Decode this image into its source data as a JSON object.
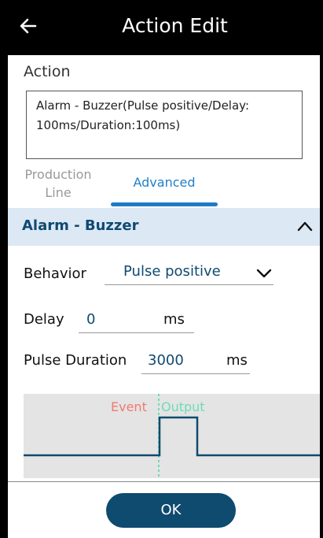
{
  "header": {
    "title": "Action Edit",
    "back_icon": "arrow-left-icon"
  },
  "action": {
    "label": "Action",
    "description": "Alarm - Buzzer(Pulse positive/Delay: 100ms/Duration:100ms)"
  },
  "tabs": [
    {
      "label": "Production\nLine",
      "selected": false
    },
    {
      "label": "Advanced",
      "selected": true
    }
  ],
  "panel": {
    "title": "Alarm - Buzzer",
    "expanded": true,
    "chevron_icon": "chevron-up-icon",
    "behavior": {
      "label": "Behavior",
      "value": "Pulse positive",
      "chevron_icon": "chevron-down-icon"
    },
    "delay": {
      "label": "Delay",
      "value": "0",
      "unit": "ms"
    },
    "pulse_duration": {
      "label": "Pulse Duration",
      "value": "3000",
      "unit": "ms"
    },
    "diagram": {
      "event_label": "Event",
      "output_label": "Output"
    }
  },
  "footer": {
    "ok_label": "OK"
  },
  "colors": {
    "header_bg": "#000000",
    "accent": "#1f7bc8",
    "brand_dark": "#0f4a6f",
    "panel_header_bg": "#dde8f5",
    "event": "#f07a70",
    "output": "#6cdcb8"
  }
}
